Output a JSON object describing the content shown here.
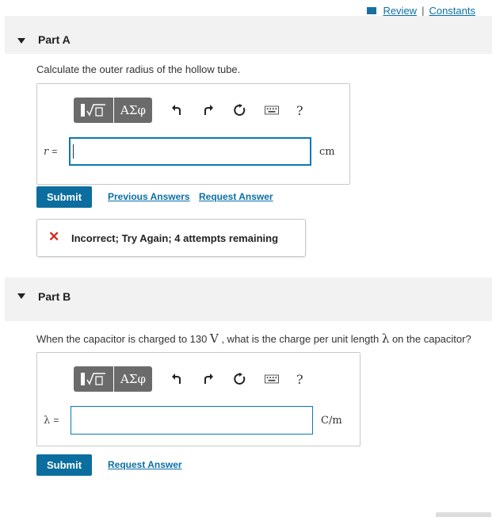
{
  "top_links": {
    "review": "Review",
    "separator": "|",
    "constants": "Constants"
  },
  "part_a": {
    "title": "Part A",
    "question": "Calculate the outer radius of the hollow tube.",
    "toolbar": {
      "greek_label": "ΑΣφ",
      "help_label": "?"
    },
    "variable_label": "r",
    "equals": "=",
    "input_value": "",
    "unit": "cm",
    "submit_label": "Submit",
    "previous_answers_label": "Previous Answers",
    "request_answer_label": "Request Answer",
    "feedback": {
      "icon": "✕",
      "message": "Incorrect; Try Again; 4 attempts remaining"
    }
  },
  "part_b": {
    "title": "Part B",
    "question_prefix": "When the capacitor is charged to 130",
    "question_unit": "V",
    "question_middle": ", what is the charge per unit length",
    "question_symbol": "λ",
    "question_suffix": "on the capacitor?",
    "toolbar": {
      "greek_label": "ΑΣφ",
      "help_label": "?"
    },
    "variable_label": "λ",
    "equals": "=",
    "input_value": "",
    "unit": "C/m",
    "submit_label": "Submit",
    "request_answer_label": "Request Answer"
  },
  "colors": {
    "accent": "#0b6e9e",
    "link": "#0a6fa6",
    "error": "#d32a1e",
    "toolbar": "#6b6b6b"
  }
}
